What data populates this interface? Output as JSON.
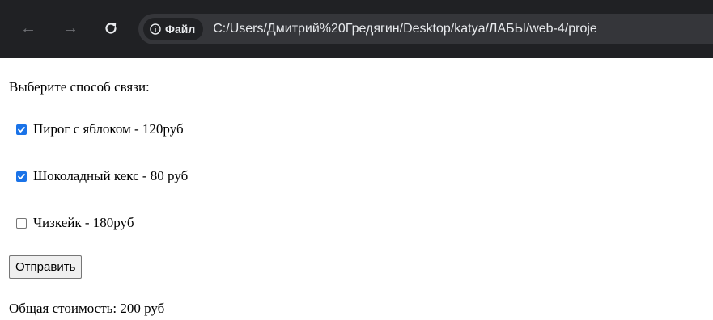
{
  "browser": {
    "chip_label": "Файл",
    "url": "C:/Users/Дмитрий%20Гредягин/Desktop/katya/ЛАБЫ/web-4/proje",
    "icons": [
      "back-arrow-icon",
      "forward-arrow-icon",
      "reload-icon",
      "info-icon"
    ]
  },
  "form": {
    "prompt": "Выберите способ связи:",
    "options": [
      {
        "label": "Пирог с яблоком - 120руб",
        "checked": true
      },
      {
        "label": "Шоколадный кекс - 80 руб",
        "checked": true
      },
      {
        "label": "Чизкейк - 180руб",
        "checked": false
      }
    ],
    "submit_label": "Отправить",
    "total": "Общая стоимость: 200 руб"
  },
  "colors": {
    "toolbar_bg": "#202124",
    "omnibox_bg": "#35363a",
    "checkbox_accent": "#1a73e8"
  }
}
